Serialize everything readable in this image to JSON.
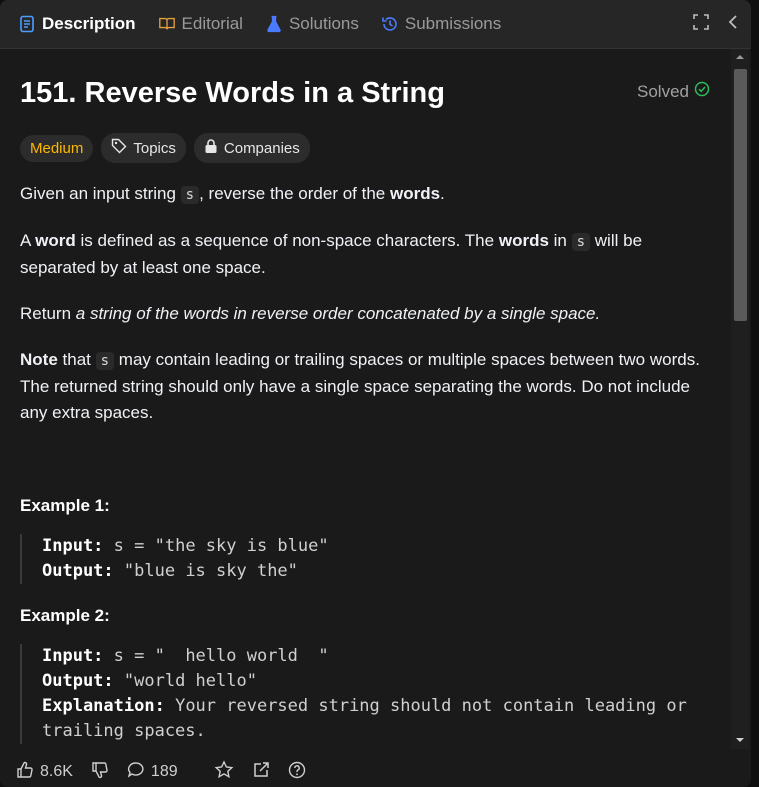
{
  "tabs": [
    {
      "label": "Description"
    },
    {
      "label": "Editorial"
    },
    {
      "label": "Solutions"
    },
    {
      "label": "Submissions"
    }
  ],
  "problem": {
    "title": "151. Reverse Words in a String",
    "solved": "Solved",
    "difficulty": "Medium",
    "topics": "Topics",
    "companies": "Companies"
  },
  "desc": {
    "p1a": "Given an input string",
    "p1code": "s",
    "p1b": ", reverse the order of the",
    "p1bold": "words",
    "p1end": ".",
    "p2a": "A",
    "p2bold1": "word",
    "p2b": "is defined as a sequence of non-space characters. The",
    "p2bold2": "words",
    "p2c": "in",
    "p2code": "s",
    "p2d": "will be separated by at least one space.",
    "p3a": "Return",
    "p3italic": "a string of the words in reverse order concatenated by a single space.",
    "p4bold": "Note",
    "p4a": "that",
    "p4code": "s",
    "p4b": "may contain leading or trailing spaces or multiple spaces between two words. The returned string should only have a single space separating the words. Do not include any extra spaces."
  },
  "examples": [
    {
      "title": "Example 1:",
      "input_label": "Input:",
      "input": "s = \"the sky is blue\"",
      "output_label": "Output:",
      "output": "\"blue is sky the\""
    },
    {
      "title": "Example 2:",
      "input_label": "Input:",
      "input": "s = \"  hello world  \"",
      "output_label": "Output:",
      "output": "\"world hello\"",
      "explanation_label": "Explanation:",
      "explanation": "Your reversed string should not contain leading or trailing spaces."
    }
  ],
  "footer": {
    "likes": "8.6K",
    "comments": "189"
  },
  "colors": {
    "difficulty": "#ffb800",
    "solved_check": "#2cbb5d",
    "description_icon": "#4a9eff",
    "solutions_icon": "#4a7bff",
    "submissions_icon": "#4a7bff",
    "editorial_icon": "#e0a040"
  }
}
